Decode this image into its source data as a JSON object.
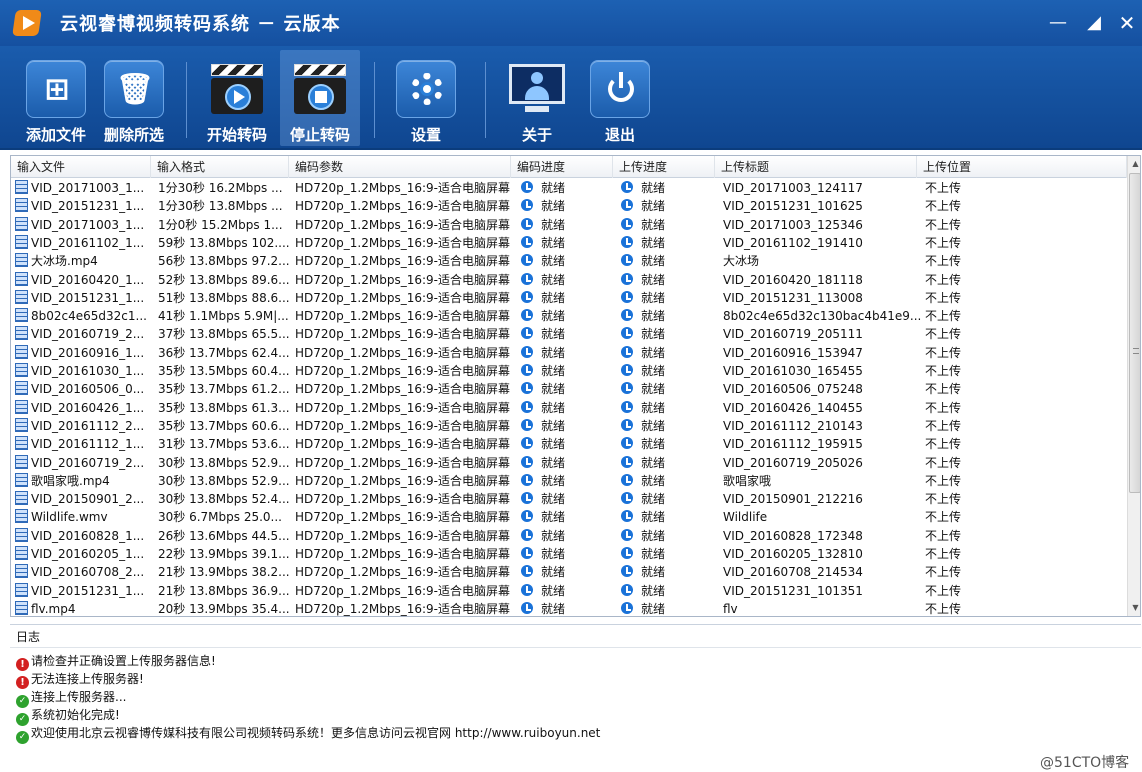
{
  "window": {
    "title": "云视睿博视频转码系统 － 云版本",
    "controls": {
      "minimize": "—",
      "restore": "◢",
      "close": "✕"
    }
  },
  "toolbar": {
    "add_files": "添加文件",
    "delete_selected": "删除所选",
    "start_transcode": "开始转码",
    "stop_transcode": "停止转码",
    "settings": "设置",
    "about": "关于",
    "exit": "退出"
  },
  "table": {
    "columns": [
      "输入文件",
      "输入格式",
      "编码参数",
      "编码进度",
      "上传进度",
      "上传标题",
      "上传位置"
    ],
    "rows": [
      {
        "file": "VID_20171003_1...",
        "format": "1分30秒 16.2Mbps ...",
        "params": "HD720p_1.2Mbps_16:9-适合电脑屏幕",
        "encode": "就绪",
        "upload": "就绪",
        "title": "VID_20171003_124117",
        "dest": "不上传"
      },
      {
        "file": "VID_20151231_1...",
        "format": "1分30秒 13.8Mbps ...",
        "params": "HD720p_1.2Mbps_16:9-适合电脑屏幕",
        "encode": "就绪",
        "upload": "就绪",
        "title": "VID_20151231_101625",
        "dest": "不上传"
      },
      {
        "file": "VID_20171003_1...",
        "format": "1分0秒 15.2Mbps 1...",
        "params": "HD720p_1.2Mbps_16:9-适合电脑屏幕",
        "encode": "就绪",
        "upload": "就绪",
        "title": "VID_20171003_125346",
        "dest": "不上传"
      },
      {
        "file": "VID_20161102_1...",
        "format": "59秒 13.8Mbps 102....",
        "params": "HD720p_1.2Mbps_16:9-适合电脑屏幕",
        "encode": "就绪",
        "upload": "就绪",
        "title": "VID_20161102_191410",
        "dest": "不上传"
      },
      {
        "file": "大冰场.mp4",
        "format": "56秒 13.8Mbps 97.2...",
        "params": "HD720p_1.2Mbps_16:9-适合电脑屏幕",
        "encode": "就绪",
        "upload": "就绪",
        "title": "大冰场",
        "dest": "不上传"
      },
      {
        "file": "VID_20160420_1...",
        "format": "52秒 13.8Mbps 89.6...",
        "params": "HD720p_1.2Mbps_16:9-适合电脑屏幕",
        "encode": "就绪",
        "upload": "就绪",
        "title": "VID_20160420_181118",
        "dest": "不上传"
      },
      {
        "file": "VID_20151231_1...",
        "format": "51秒 13.8Mbps 88.6...",
        "params": "HD720p_1.2Mbps_16:9-适合电脑屏幕",
        "encode": "就绪",
        "upload": "就绪",
        "title": "VID_20151231_113008",
        "dest": "不上传"
      },
      {
        "file": "8b02c4e65d32c1...",
        "format": "41秒 1.1Mbps 5.9M|...",
        "params": "HD720p_1.2Mbps_16:9-适合电脑屏幕",
        "encode": "就绪",
        "upload": "就绪",
        "title": "8b02c4e65d32c130bac4b41e9...",
        "dest": "不上传"
      },
      {
        "file": "VID_20160719_2...",
        "format": "37秒 13.8Mbps 65.5...",
        "params": "HD720p_1.2Mbps_16:9-适合电脑屏幕",
        "encode": "就绪",
        "upload": "就绪",
        "title": "VID_20160719_205111",
        "dest": "不上传"
      },
      {
        "file": "VID_20160916_1...",
        "format": "36秒 13.7Mbps 62.4...",
        "params": "HD720p_1.2Mbps_16:9-适合电脑屏幕",
        "encode": "就绪",
        "upload": "就绪",
        "title": "VID_20160916_153947",
        "dest": "不上传"
      },
      {
        "file": "VID_20161030_1...",
        "format": "35秒 13.5Mbps 60.4...",
        "params": "HD720p_1.2Mbps_16:9-适合电脑屏幕",
        "encode": "就绪",
        "upload": "就绪",
        "title": "VID_20161030_165455",
        "dest": "不上传"
      },
      {
        "file": "VID_20160506_0...",
        "format": "35秒 13.7Mbps 61.2...",
        "params": "HD720p_1.2Mbps_16:9-适合电脑屏幕",
        "encode": "就绪",
        "upload": "就绪",
        "title": "VID_20160506_075248",
        "dest": "不上传"
      },
      {
        "file": "VID_20160426_1...",
        "format": "35秒 13.8Mbps 61.3...",
        "params": "HD720p_1.2Mbps_16:9-适合电脑屏幕",
        "encode": "就绪",
        "upload": "就绪",
        "title": "VID_20160426_140455",
        "dest": "不上传"
      },
      {
        "file": "VID_20161112_2...",
        "format": "35秒 13.7Mbps 60.6...",
        "params": "HD720p_1.2Mbps_16:9-适合电脑屏幕",
        "encode": "就绪",
        "upload": "就绪",
        "title": "VID_20161112_210143",
        "dest": "不上传"
      },
      {
        "file": "VID_20161112_1...",
        "format": "31秒 13.7Mbps 53.6...",
        "params": "HD720p_1.2Mbps_16:9-适合电脑屏幕",
        "encode": "就绪",
        "upload": "就绪",
        "title": "VID_20161112_195915",
        "dest": "不上传"
      },
      {
        "file": "VID_20160719_2...",
        "format": "30秒 13.8Mbps 52.9...",
        "params": "HD720p_1.2Mbps_16:9-适合电脑屏幕",
        "encode": "就绪",
        "upload": "就绪",
        "title": "VID_20160719_205026",
        "dest": "不上传"
      },
      {
        "file": "歌唱家哦.mp4",
        "format": "30秒 13.8Mbps 52.9...",
        "params": "HD720p_1.2Mbps_16:9-适合电脑屏幕",
        "encode": "就绪",
        "upload": "就绪",
        "title": "歌唱家哦",
        "dest": "不上传"
      },
      {
        "file": "VID_20150901_2...",
        "format": "30秒 13.8Mbps 52.4...",
        "params": "HD720p_1.2Mbps_16:9-适合电脑屏幕",
        "encode": "就绪",
        "upload": "就绪",
        "title": "VID_20150901_212216",
        "dest": "不上传"
      },
      {
        "file": "Wildlife.wmv",
        "format": "30秒 6.7Mbps 25.0...",
        "params": "HD720p_1.2Mbps_16:9-适合电脑屏幕",
        "encode": "就绪",
        "upload": "就绪",
        "title": "Wildlife",
        "dest": "不上传"
      },
      {
        "file": "VID_20160828_1...",
        "format": "26秒 13.6Mbps 44.5...",
        "params": "HD720p_1.2Mbps_16:9-适合电脑屏幕",
        "encode": "就绪",
        "upload": "就绪",
        "title": "VID_20160828_172348",
        "dest": "不上传"
      },
      {
        "file": "VID_20160205_1...",
        "format": "22秒 13.9Mbps 39.1...",
        "params": "HD720p_1.2Mbps_16:9-适合电脑屏幕",
        "encode": "就绪",
        "upload": "就绪",
        "title": "VID_20160205_132810",
        "dest": "不上传"
      },
      {
        "file": "VID_20160708_2...",
        "format": "21秒 13.9Mbps 38.2...",
        "params": "HD720p_1.2Mbps_16:9-适合电脑屏幕",
        "encode": "就绪",
        "upload": "就绪",
        "title": "VID_20160708_214534",
        "dest": "不上传"
      },
      {
        "file": "VID_20151231_1...",
        "format": "21秒 13.8Mbps 36.9...",
        "params": "HD720p_1.2Mbps_16:9-适合电脑屏幕",
        "encode": "就绪",
        "upload": "就绪",
        "title": "VID_20151231_101351",
        "dest": "不上传"
      },
      {
        "file": "flv.mp4",
        "format": "20秒 13.9Mbps 35.4...",
        "params": "HD720p_1.2Mbps_16:9-适合电脑屏幕",
        "encode": "就绪",
        "upload": "就绪",
        "title": "flv",
        "dest": "不上传"
      }
    ]
  },
  "log": {
    "title": "日志",
    "entries": [
      {
        "type": "error",
        "text": "请检查并正确设置上传服务器信息!"
      },
      {
        "type": "error",
        "text": "无法连接上传服务器!"
      },
      {
        "type": "ok",
        "text": "连接上传服务器..."
      },
      {
        "type": "ok",
        "text": "系统初始化完成!"
      },
      {
        "type": "ok",
        "text": "欢迎使用北京云视睿博传媒科技有限公司视频转码系统！更多信息访问云视官网 http://www.ruiboyun.net"
      }
    ]
  },
  "watermark": "@51CTO博客"
}
